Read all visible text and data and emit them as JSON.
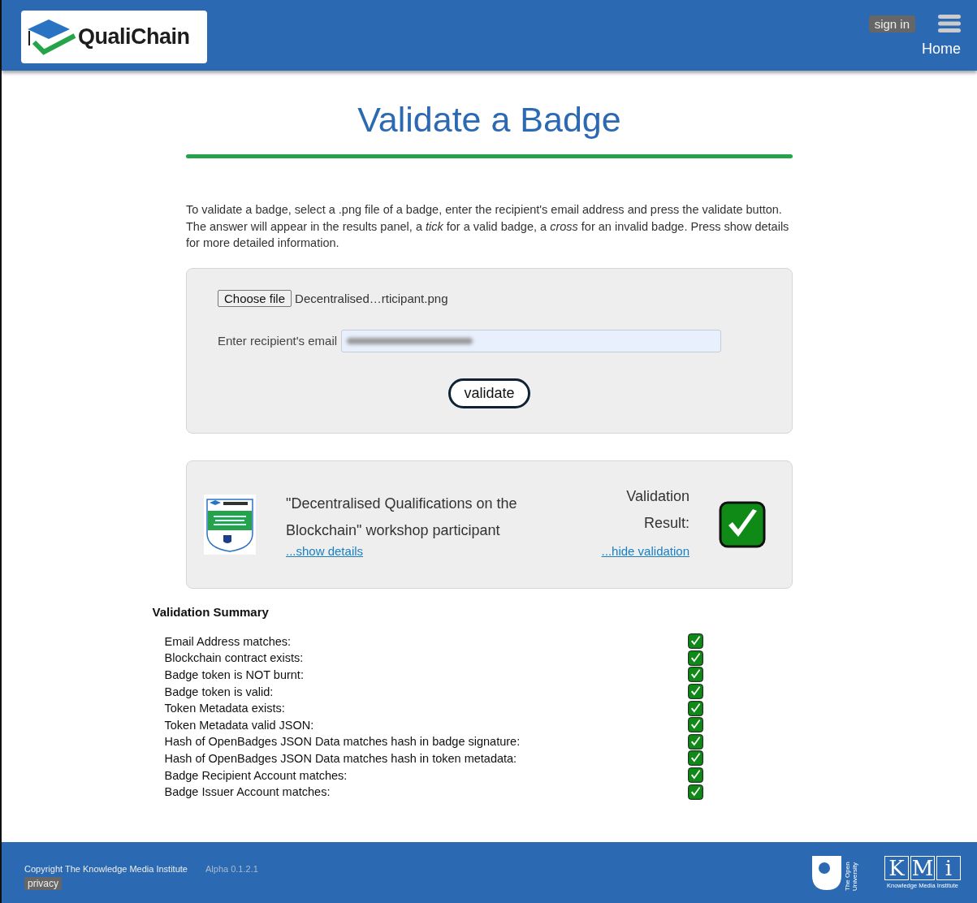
{
  "header": {
    "logo_text": "QualiChain",
    "sign_in": "sign in",
    "nav_link": "Home"
  },
  "title": "Validate a Badge",
  "intro": [
    "To validate a badge, select a .png file of a badge, enter the recipient's email address and press the validate button.",
    "The answer will appear in the results panel, a *tick* for a valid badge, a *cross* for an invalid badge. Press show details for more detailed information."
  ],
  "form": {
    "file_button": "Choose file",
    "file_name": "Decentralised…rticipant.png",
    "email_label": "Enter recipient's email",
    "email_redacted": true,
    "submit": "validate"
  },
  "result": {
    "badge_name": "\"Decentralised Qualifications on the Blockchain\" workshop participant",
    "show_details": "...show details",
    "result_label": "Validation Result:",
    "hide_link": "...hide validation",
    "valid": true
  },
  "summary": {
    "title": "Validation Summary",
    "checks": [
      {
        "label": "Email Address matches:",
        "passed": true
      },
      {
        "label": "Blockchain contract exists:",
        "passed": true
      },
      {
        "label": "Badge token is NOT burnt:",
        "passed": true
      },
      {
        "label": "Badge token is valid:",
        "passed": true
      },
      {
        "label": "Token Metadata exists:",
        "passed": true
      },
      {
        "label": "Token Metadata valid JSON:",
        "passed": true
      },
      {
        "label": "Hash of OpenBadges JSON Data matches hash in badge signature:",
        "passed": true
      },
      {
        "label": "Hash of OpenBadges JSON Data matches hash in token metadata:",
        "passed": true
      },
      {
        "label": "Badge Recipient Account matches:",
        "passed": true
      },
      {
        "label": "Badge Issuer Account matches:",
        "passed": true
      }
    ]
  },
  "footer": {
    "copyright": "Copyright The Knowledge Media Institute",
    "version": "Alpha 0.1.2.1",
    "privacy": "privacy",
    "ou_text": "The Open University",
    "kmi_letters": [
      "K",
      "M",
      "i"
    ],
    "kmi_caption": "Knowledge Media Institute"
  }
}
